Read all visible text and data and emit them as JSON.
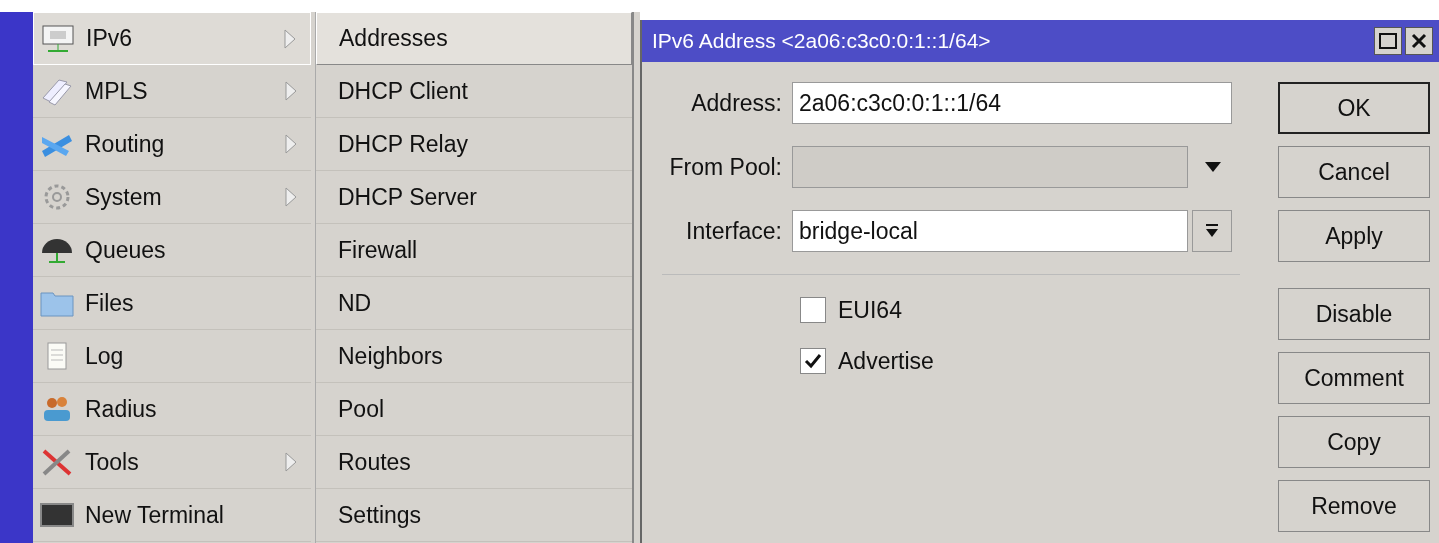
{
  "main_menu": [
    {
      "label": "IPv6",
      "has_submenu": true,
      "selected": true
    },
    {
      "label": "MPLS",
      "has_submenu": true,
      "selected": false
    },
    {
      "label": "Routing",
      "has_submenu": true,
      "selected": false
    },
    {
      "label": "System",
      "has_submenu": true,
      "selected": false
    },
    {
      "label": "Queues",
      "has_submenu": false,
      "selected": false
    },
    {
      "label": "Files",
      "has_submenu": false,
      "selected": false
    },
    {
      "label": "Log",
      "has_submenu": false,
      "selected": false
    },
    {
      "label": "Radius",
      "has_submenu": false,
      "selected": false
    },
    {
      "label": "Tools",
      "has_submenu": true,
      "selected": false
    },
    {
      "label": "New Terminal",
      "has_submenu": false,
      "selected": false
    }
  ],
  "submenu": [
    {
      "label": "Addresses",
      "selected": true
    },
    {
      "label": "DHCP Client",
      "selected": false
    },
    {
      "label": "DHCP Relay",
      "selected": false
    },
    {
      "label": "DHCP Server",
      "selected": false
    },
    {
      "label": "Firewall",
      "selected": false
    },
    {
      "label": "ND",
      "selected": false
    },
    {
      "label": "Neighbors",
      "selected": false
    },
    {
      "label": "Pool",
      "selected": false
    },
    {
      "label": "Routes",
      "selected": false
    },
    {
      "label": "Settings",
      "selected": false
    }
  ],
  "dialog": {
    "title": "IPv6 Address <2a06:c3c0:0:1::1/64>",
    "fields": [
      {
        "kind": "text",
        "label": "Address:",
        "value": "2a06:c3c0:0:1::1/64",
        "disabled": false
      },
      {
        "kind": "dropdown",
        "label": "From Pool:",
        "disabled": true
      },
      {
        "kind": "combo",
        "label": "Interface:",
        "value": "bridge-local",
        "disabled": false
      }
    ],
    "checkboxes": [
      {
        "label": "EUI64",
        "checked": false
      },
      {
        "label": "Advertise",
        "checked": true
      }
    ],
    "buttons": [
      {
        "label": "OK",
        "default": true,
        "group_start": false
      },
      {
        "label": "Cancel",
        "default": false,
        "group_start": false
      },
      {
        "label": "Apply",
        "default": false,
        "group_start": false
      },
      {
        "label": "Disable",
        "default": false,
        "group_start": true
      },
      {
        "label": "Comment",
        "default": false,
        "group_start": false
      },
      {
        "label": "Copy",
        "default": false,
        "group_start": false
      },
      {
        "label": "Remove",
        "default": false,
        "group_start": false
      }
    ]
  }
}
